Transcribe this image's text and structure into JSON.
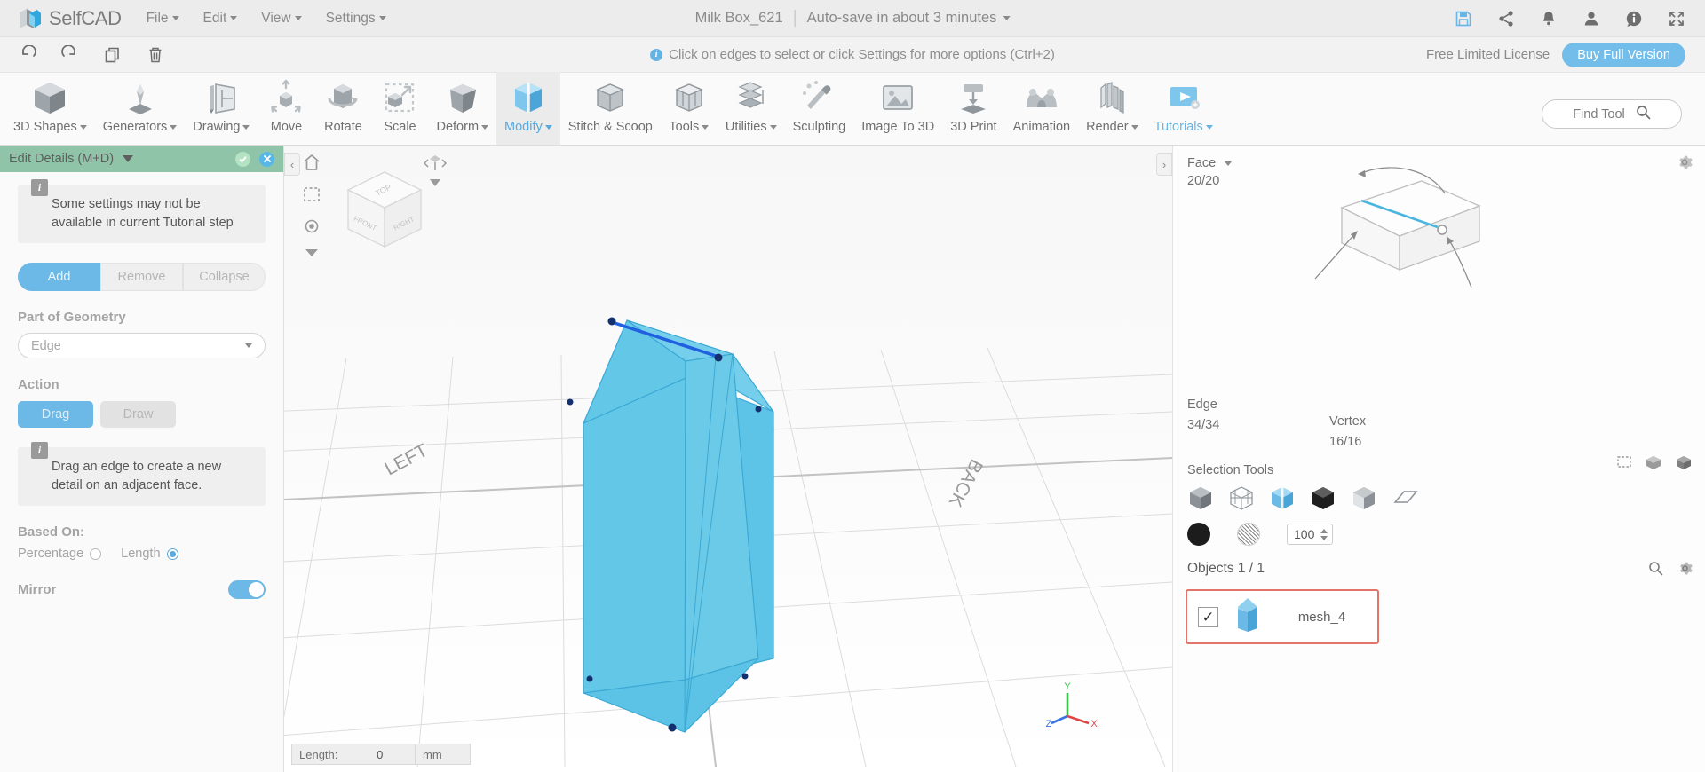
{
  "app": {
    "brand": "SelfCAD",
    "menu": [
      {
        "label": "File",
        "caret": true
      },
      {
        "label": "Edit",
        "caret": true
      },
      {
        "label": "View",
        "caret": true
      },
      {
        "label": "Settings",
        "caret": true
      }
    ],
    "project_title": "Milk Box_621",
    "autosave": "Auto-save in about 3 minutes",
    "top_icons": [
      {
        "name": "save-icon",
        "glyph": "save"
      },
      {
        "name": "share-icon",
        "glyph": "share"
      },
      {
        "name": "notifications-bell-icon",
        "glyph": "bell"
      },
      {
        "name": "user-account-icon",
        "glyph": "user"
      },
      {
        "name": "info-icon",
        "glyph": "info"
      },
      {
        "name": "fullscreen-icon",
        "glyph": "fullscreen"
      }
    ],
    "accent_blue": "#6cb8e6",
    "accent_green": "#8fc4a8",
    "selection_red": "#e3746a"
  },
  "subbar": {
    "undo_label": "Undo",
    "redo_label": "Redo",
    "copy_label": "Copy",
    "delete_label": "Delete",
    "hint": "Click on edges to select or click Settings for more options (Ctrl+2)",
    "license_text": "Free Limited License",
    "buy_label": "Buy Full Version"
  },
  "ribbon": {
    "tools": [
      {
        "label": "3D Shapes",
        "caret": true,
        "icon": "cube-icon",
        "state": "normal"
      },
      {
        "label": "Generators",
        "caret": true,
        "icon": "lathe-icon",
        "state": "normal"
      },
      {
        "label": "Drawing",
        "caret": true,
        "icon": "pencil-sketch-icon",
        "state": "normal"
      },
      {
        "label": "Move",
        "caret": false,
        "icon": "move-arrows-icon",
        "state": "normal"
      },
      {
        "label": "Rotate",
        "caret": false,
        "icon": "rotate-icon",
        "state": "normal"
      },
      {
        "label": "Scale",
        "caret": false,
        "icon": "scale-icon",
        "state": "normal"
      },
      {
        "label": "Deform",
        "caret": true,
        "icon": "deform-icon",
        "state": "normal"
      },
      {
        "label": "Modify",
        "caret": true,
        "icon": "modify-icon",
        "state": "active"
      },
      {
        "label": "Stitch & Scoop",
        "caret": false,
        "icon": "stitch-scoop-icon",
        "state": "normal"
      },
      {
        "label": "Tools",
        "caret": true,
        "icon": "tools-icon",
        "state": "normal"
      },
      {
        "label": "Utilities",
        "caret": true,
        "icon": "utilities-icon",
        "state": "normal"
      },
      {
        "label": "Sculpting",
        "caret": false,
        "icon": "sculpting-brush-icon",
        "state": "normal"
      },
      {
        "label": "Image To 3D",
        "caret": false,
        "icon": "image-to-3d-icon",
        "state": "normal"
      },
      {
        "label": "3D Print",
        "caret": false,
        "icon": "3d-print-icon",
        "state": "normal"
      },
      {
        "label": "Animation",
        "caret": false,
        "icon": "animation-icon",
        "state": "normal"
      },
      {
        "label": "Render",
        "caret": true,
        "icon": "render-icon",
        "state": "normal"
      },
      {
        "label": "Tutorials",
        "caret": true,
        "icon": "tutorials-icon",
        "state": "accent"
      }
    ],
    "find_tool_label": "Find Tool"
  },
  "left_panel": {
    "header_title": "Edit Details (M+D)",
    "confirm_label": "Apply",
    "cancel_label": "Cancel",
    "notice": "Some settings may not be available in current Tutorial step",
    "mode_buttons": [
      {
        "label": "Add",
        "selected": true
      },
      {
        "label": "Remove",
        "selected": false
      },
      {
        "label": "Collapse",
        "selected": false
      }
    ],
    "part_of_geometry_label": "Part of Geometry",
    "part_of_geometry_value": "Edge",
    "action_label": "Action",
    "action_buttons": [
      {
        "label": "Drag",
        "selected": true
      },
      {
        "label": "Draw",
        "selected": false
      }
    ],
    "action_hint": "Drag an edge to create a new detail on an adjacent face.",
    "based_on_label": "Based On:",
    "based_on_options": [
      {
        "label": "Percentage",
        "selected": false
      },
      {
        "label": "Length",
        "selected": true
      }
    ],
    "mirror_label": "Mirror",
    "mirror_on": true
  },
  "viewport": {
    "collapse_left": "‹",
    "collapse_right": "›",
    "tools": [
      {
        "name": "home-view-icon"
      },
      {
        "name": "select-region-icon"
      },
      {
        "name": "orbit-target-icon"
      }
    ],
    "navcube_faces": {
      "top": "TOP",
      "left": "FRONT",
      "right": "RIGHT"
    },
    "ground_labels": {
      "left": "LEFT",
      "back": "BACK"
    },
    "length_label": "Length:",
    "length_value": "0",
    "length_unit": "mm",
    "axes": {
      "x": "X",
      "y": "Y",
      "z": "Z"
    }
  },
  "right_panel": {
    "face_label": "Face",
    "face_count": "20/20",
    "edge_label": "Edge",
    "edge_count": "34/34",
    "vertex_label": "Vertex",
    "vertex_count": "16/16",
    "selection_tools_label": "Selection Tools",
    "selection_mode_icons": [
      {
        "name": "select-solid-icon",
        "active": false
      },
      {
        "name": "select-wireframe-icon",
        "active": false
      },
      {
        "name": "select-transparent-icon",
        "active": true
      },
      {
        "name": "select-outline-icon",
        "active": false
      },
      {
        "name": "select-face-icon",
        "active": false
      },
      {
        "name": "select-plane-icon",
        "active": false
      }
    ],
    "selection_extra_icons": [
      {
        "name": "select-rect-icon"
      },
      {
        "name": "select-box-icon"
      },
      {
        "name": "select-volume-icon"
      }
    ],
    "material_color": "#1c1c1c",
    "opacity_value": "100",
    "objects_label": "Objects 1 / 1",
    "search_icon": "search-icon",
    "settings_icon": "gear-icon",
    "objects": [
      {
        "name": "mesh_4",
        "checked": true,
        "selected": true
      }
    ]
  }
}
